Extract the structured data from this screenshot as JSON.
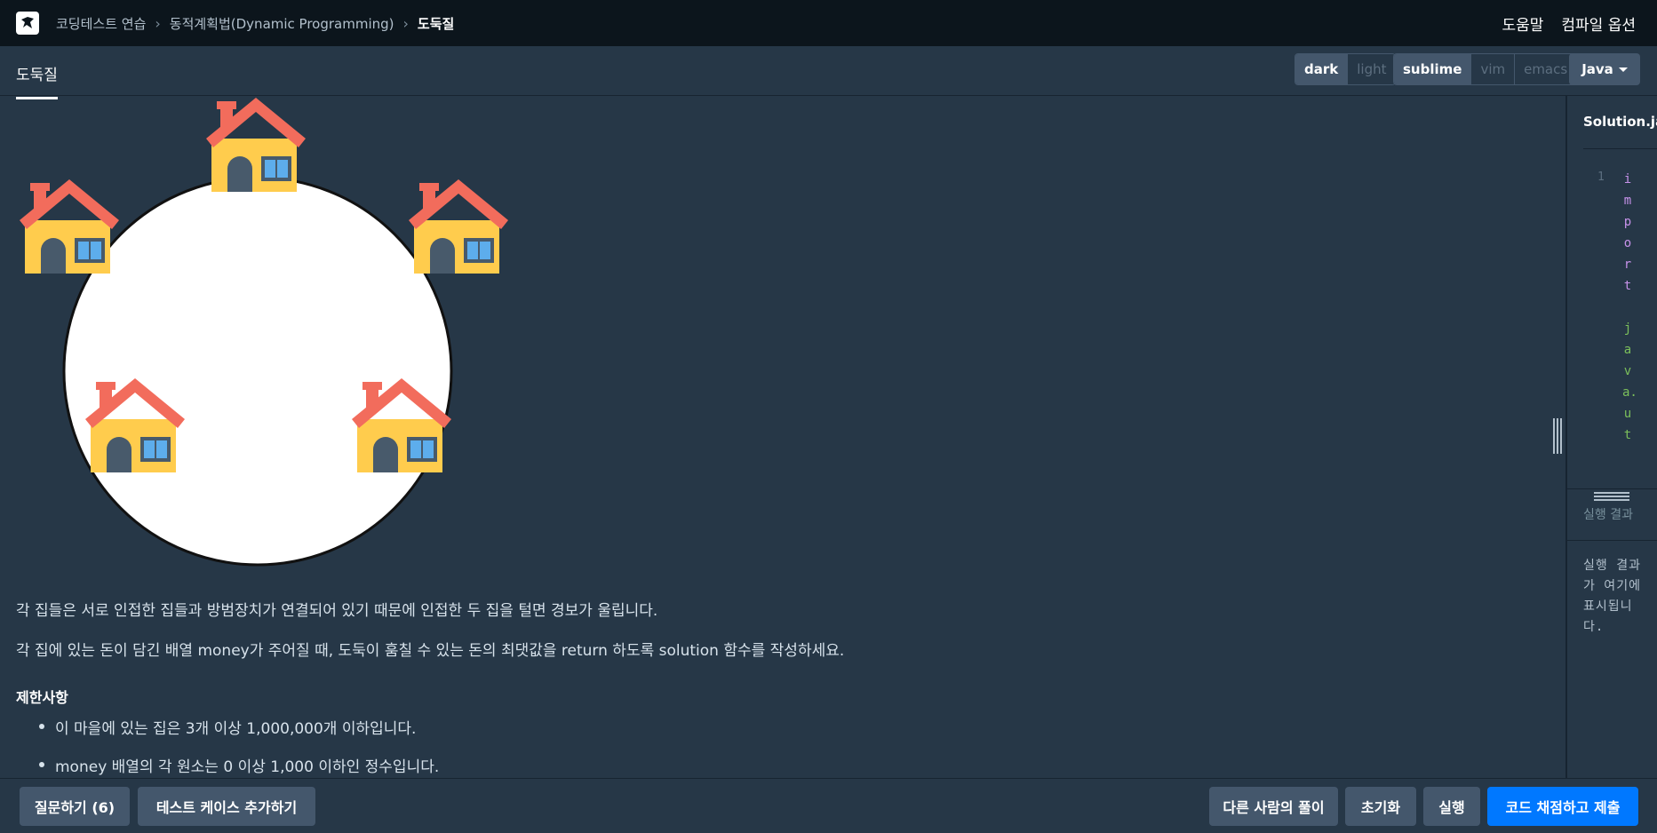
{
  "nav": {
    "breadcrumb": [
      "코딩테스트 연습",
      "동적계획법(Dynamic Programming)",
      "도둑질"
    ],
    "help": "도움말",
    "compile_options": "컴파일 옵션"
  },
  "tabs": {
    "active": "도둑질"
  },
  "theme": {
    "options": [
      "dark",
      "light"
    ],
    "selected": "dark"
  },
  "keymap": {
    "options": [
      "sublime",
      "vim",
      "emacs"
    ],
    "selected": "sublime"
  },
  "language": {
    "selected": "Java"
  },
  "description": {
    "paragraph1": "각 집들은 서로 인접한 집들과 방범장치가 연결되어 있기 때문에 인접한 두 집을 털면 경보가 울립니다.",
    "paragraph2": "각 집에 있는 돈이 담긴 배열 money가 주어질 때, 도둑이 훔칠 수 있는 돈의 최댓값을 return 하도록 solution 함수를 작성하세요.",
    "limits_heading": "제한사항",
    "limits": [
      "이 마을에 있는 집은 3개 이상 1,000,000개 이하입니다.",
      "money 배열의 각 원소는 0 이상 1,000 이하인 정수입니다."
    ]
  },
  "editor": {
    "file_name": "Solution.java",
    "line_number": "1",
    "code_keyword": "import",
    "code_package": "java.ut"
  },
  "result": {
    "tab_label": "실행 결과",
    "placeholder": "실행 결과가 여기에 표시됩니다."
  },
  "bottom": {
    "question": "질문하기 (6)",
    "add_testcase": "테스트 케이스 추가하기",
    "others_solutions": "다른 사람의 풀이",
    "reset": "초기화",
    "run": "실행",
    "submit": "코드 채점하고 제출"
  },
  "colors": {
    "nav_bg": "#0c151c",
    "panel_bg": "#263747",
    "button_bg": "#44576c",
    "primary": "#0078ff",
    "house_roof": "#f26c5c",
    "house_wall": "#ffcc4d",
    "house_window": "#5dadec"
  },
  "icons": [
    "logo-icon",
    "chevron-right-icon",
    "caret-down-icon",
    "house-icon",
    "resize-grip-icon"
  ]
}
